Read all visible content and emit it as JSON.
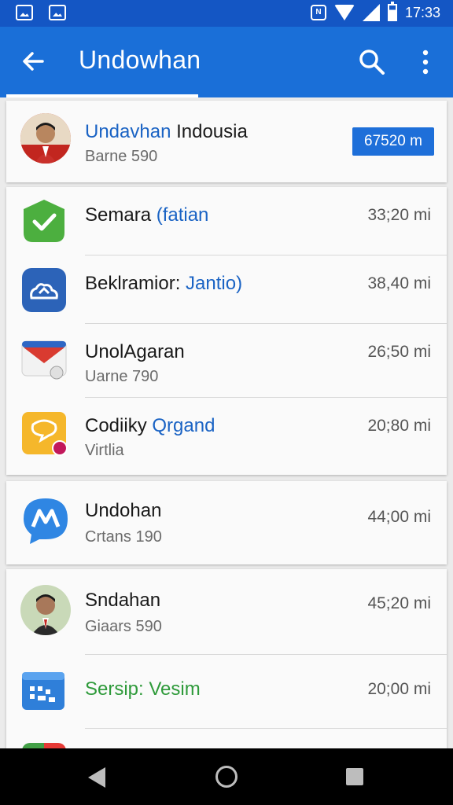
{
  "status_bar": {
    "time": "17:33",
    "nfc_label": "N"
  },
  "app_bar": {
    "title": "Undowhan"
  },
  "header_card": {
    "title_accent": "Undavhan",
    "title_rest": " Indousia",
    "subtitle": "Barne 590",
    "badge": "67520 m"
  },
  "items": [
    {
      "title": "Semara ",
      "title_accent": "(fatian",
      "time": "33;20 mi"
    },
    {
      "title": "Beklramior: ",
      "title_accent": "Jantio)",
      "time": "38,40 mi"
    },
    {
      "title": "UnolAgaran",
      "subtitle": "Uarne 790",
      "time": "26;50 mi"
    },
    {
      "title": "Codiiky ",
      "title_accent": "Qrgand",
      "subtitle": "Virtlia",
      "time": "20;80 mi"
    },
    {
      "title": "Undohan",
      "subtitle": "Crtans 190",
      "time": "44;00 mi"
    },
    {
      "title": "Sndahan",
      "subtitle": "Giaars 590",
      "time": "45;20 mi"
    },
    {
      "title": "Sersip: Vesim",
      "time": "20;00 mi"
    }
  ],
  "colors": {
    "app_bar": "#1a6fd8",
    "status_bar": "#1456c4",
    "accent_text": "#1a63c4",
    "green_text": "#2e9a3a"
  }
}
